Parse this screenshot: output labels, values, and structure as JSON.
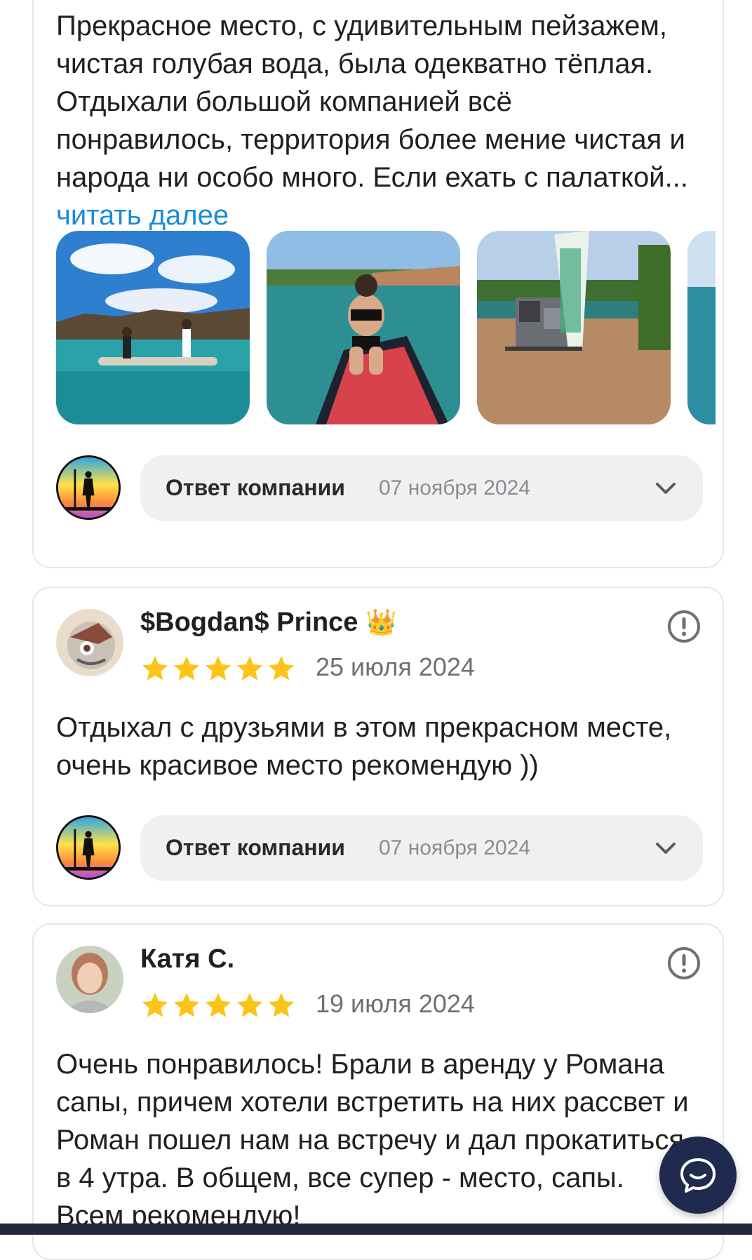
{
  "review1": {
    "text": "Прекрасное место, с удивительным пейзажем, чистая голубая вода, была одекватно тёплая. Отдыхали большой компанией всё понравилось, территория более мение чистая и народа ни особо много. Если ехать с палаткой...",
    "read_more": "читать далее",
    "photos": [
      "photo-sup-boards-lake",
      "photo-girl-on-sup",
      "photo-rental-sign-trailer"
    ],
    "reply": {
      "label": "Ответ компании",
      "date": "07 ноября 2024"
    }
  },
  "review2": {
    "author": "$Bogdan$ Prince",
    "author_badge": "👑",
    "rating": 5,
    "date": "25 июля 2024",
    "text": "Отдыхал с друзьями в этом прекрасном месте, очень красивое место рекомендую ))",
    "reply": {
      "label": "Ответ компании",
      "date": "07 ноября 2024"
    }
  },
  "review3": {
    "author": "Катя С.",
    "rating": 5,
    "date": "19 июля 2024",
    "text": "Очень понравилось! Брали в аренду у Романа сапы, причем хотели встретить на них рассвет и Роман пошел нам на встречу и дал прокатиться в 4 утра. В общем, все супер - место, сапы. Всем рекомендую!"
  },
  "colors": {
    "star": "#fcc419",
    "link": "#1a8bd8",
    "chat_button": "#1f2a4e",
    "reply_bg": "#f0f0f2"
  },
  "icons": [
    "chevron-down-icon",
    "complaint-icon",
    "chat-icon",
    "star-icon"
  ]
}
